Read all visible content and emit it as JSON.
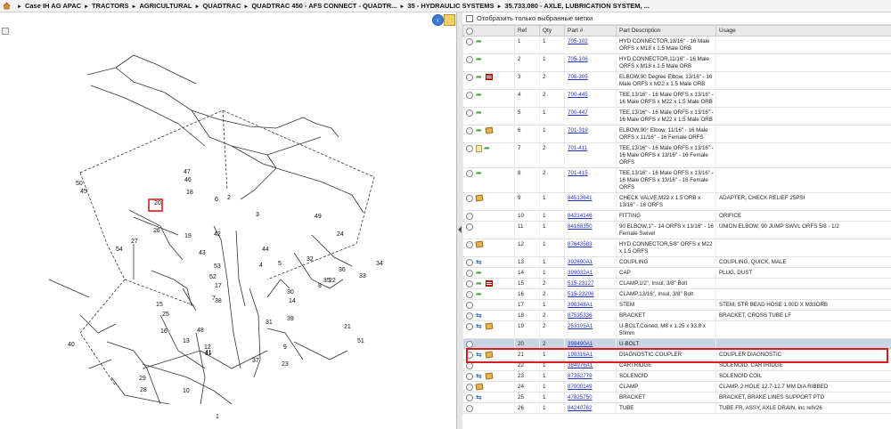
{
  "breadcrumb": {
    "items": [
      "Case IH AG APAC",
      "TRACTORS",
      "AGRICULTURAL",
      "QUADTRAC",
      "QUADTRAC 450 - AFS CONNECT - QUADTR...",
      "35 - HYDRAULIC SYSTEMS",
      "35.733.080 - AXLE, LUBRICATION SYSTEM, ..."
    ],
    "separator": "►"
  },
  "filter": {
    "label": "Отобразить только выбранные метки"
  },
  "table": {
    "headers": [
      "",
      "Ref",
      "Qty",
      "Part #",
      "Part Description",
      "Usage"
    ],
    "rows": [
      {
        "icons": [
          "arrow"
        ],
        "ref": "1",
        "qty": "1",
        "part": "705-102",
        "desc": "HYD CONNECTOR,13/16\" - 16 Male ORFS x M18 x 1.5 Male ORB",
        "usage": ""
      },
      {
        "icons": [
          "arrow"
        ],
        "ref": "2",
        "qty": "1",
        "part": "705-106",
        "desc": "HYD CONNECTOR,11/16\" - 16 Male ORFS x M18 x 1.5 Male ORB",
        "usage": ""
      },
      {
        "icons": [
          "arrow",
          "flag"
        ],
        "ref": "3",
        "qty": "2",
        "part": "708-305",
        "desc": "ELBOW,90 Degree Elbow, 13/16\" - 16 Male ORFS x M22 x 1.5 Male ORB",
        "usage": ""
      },
      {
        "icons": [
          "arrow"
        ],
        "ref": "4",
        "qty": "2",
        "part": "700-445",
        "desc": "TEE,13/16\" - 16 Male ORFS x 13/16\" - 16 Male ORFS x M22 x 1.5 Male ORB",
        "usage": ""
      },
      {
        "icons": [
          "arrow"
        ],
        "ref": "5",
        "qty": "1",
        "part": "700-447",
        "desc": "TEE,13/16\" - 16 Male ORFS x 13/16\" - 16 Male ORFS x M22 x 1.5 Male ORB",
        "usage": ""
      },
      {
        "icons": [
          "arrow",
          "box"
        ],
        "ref": "6",
        "qty": "1",
        "part": "701-319",
        "desc": "ELBOW,90° Elbow, 11/16\" - 16 Male ORFS x 11/16\" - 16 Female ORFS",
        "usage": ""
      },
      {
        "icons": [
          "note",
          "arrow"
        ],
        "ref": "7",
        "qty": "2",
        "part": "701-411",
        "desc": "TEE,13/16\" - 16 Male ORFS x 13/16\" - 16 Male ORFS x 13/16\" - 16 Female ORFS",
        "usage": ""
      },
      {
        "icons": [
          "arrow"
        ],
        "ref": "8",
        "qty": "2",
        "part": "701-415",
        "desc": "TEE,13/16\" - 16 Male ORFS x 13/16\" - 16 Male ORFS x 13/16\" - 16 Female ORFS",
        "usage": ""
      },
      {
        "icons": [
          "box"
        ],
        "ref": "9",
        "qty": "1",
        "part": "84513641",
        "desc": "CHECK VALVE,M22 x 1.5 ORB x 13/16\" - 16 ORFS",
        "usage": "ADAPTER, CHECK RELIEF 25PSI"
      },
      {
        "icons": [],
        "ref": "10",
        "qty": "1",
        "part": "84214146",
        "desc": "FITTING",
        "usage": "ORIFICE"
      },
      {
        "icons": [],
        "ref": "11",
        "qty": "1",
        "part": "84168350",
        "desc": "90 ELBOW,1\" - 14 ORFS x 13/16\" - 16 Female Swivel",
        "usage": "UNION ELBOW, 90 JUMP SWVL ORFS 5/8 - 1/2"
      },
      {
        "icons": [
          "box"
        ],
        "ref": "12",
        "qty": "1",
        "part": "87643583",
        "desc": "HYD CONNECTOR,5/8\" ORFS x M22 x 1.5 ORFS",
        "usage": ""
      },
      {
        "icons": [
          "swap"
        ],
        "ref": "13",
        "qty": "1",
        "part": "392690A1",
        "desc": "COUPLING",
        "usage": "COUPLING, QUICK, MALE"
      },
      {
        "icons": [
          "arrow"
        ],
        "ref": "14",
        "qty": "1",
        "part": "399032A1",
        "desc": "CAP",
        "usage": "PLUG, DUST"
      },
      {
        "icons": [
          "arrow",
          "flag"
        ],
        "ref": "15",
        "qty": "2",
        "part": "515-23127",
        "desc": "CLAMP,1/2\", Insul, 3/8\" Bolt",
        "usage": ""
      },
      {
        "icons": [
          "arrow"
        ],
        "ref": "16",
        "qty": "2",
        "part": "515-23206",
        "desc": "CLAMP,13/16\", Insul, 3/8\" Bolt",
        "usage": ""
      },
      {
        "icons": [],
        "ref": "17",
        "qty": "1",
        "part": "398348A1",
        "desc": "STEM",
        "usage": "STEM, STR BEAD HOSE 1.00D X M33ORB"
      },
      {
        "icons": [
          "swap"
        ],
        "ref": "18",
        "qty": "2",
        "part": "87535336",
        "desc": "BRACKET",
        "usage": "BRACKET, CROSS TUBE LF"
      },
      {
        "icons": [
          "swap",
          "box"
        ],
        "ref": "19",
        "qty": "2",
        "part": "253105A1",
        "desc": "U-BOLT,Coined, M8 x 1.25 x 33.8 x 50mm",
        "usage": ""
      },
      {
        "icons": [],
        "ref": "20",
        "qty": "2",
        "part": "398490A1",
        "desc": "U-BOLT",
        "usage": "",
        "selected": true
      },
      {
        "icons": [
          "swap",
          "box"
        ],
        "ref": "21",
        "qty": "1",
        "part": "198316A1",
        "desc": "DIAGNOSTIC COUPLER",
        "usage": "COUPLER DIAGNOSTIC"
      },
      {
        "icons": [],
        "ref": "22",
        "qty": "1",
        "part": "384976A1",
        "desc": "CARTRIDGE",
        "usage": "SOLENOID, CARTRIDGE"
      },
      {
        "icons": [
          "swap",
          "box"
        ],
        "ref": "23",
        "qty": "1",
        "part": "87352779",
        "desc": "SOLENOID",
        "usage": "SOLENOID COIL"
      },
      {
        "icons": [
          "box"
        ],
        "ref": "24",
        "qty": "1",
        "part": "87000149",
        "desc": "CLAMP",
        "usage": "CLAMP, 2 HOLE 12.7-12.7 MM DIA RIBBED"
      },
      {
        "icons": [
          "swap"
        ],
        "ref": "25",
        "qty": "1",
        "part": "47825750",
        "desc": "BRACKET",
        "usage": "BRACKET, BRAKE LINES SUPPORT PTD"
      },
      {
        "icons": [],
        "ref": "26",
        "qty": "1",
        "part": "84240762",
        "desc": "TUBE",
        "usage": "TUBE FR, ASSY, AXLE DRAIN, inc ref#26"
      }
    ]
  },
  "diagram": {
    "callouts": [
      "1",
      "2",
      "3",
      "4",
      "5",
      "6",
      "7",
      "8",
      "9",
      "10",
      "11",
      "12",
      "13",
      "14",
      "15",
      "16",
      "17",
      "18",
      "19",
      "20",
      "21",
      "22",
      "23",
      "24",
      "25",
      "26",
      "27",
      "28",
      "29",
      "30",
      "31",
      "32",
      "33",
      "34",
      "35",
      "36",
      "37",
      "38",
      "39",
      "40",
      "41",
      "42",
      "43",
      "44",
      "45",
      "46",
      "47",
      "48",
      "49",
      "50",
      "51",
      "52",
      "53",
      "54"
    ],
    "highlighted": "20"
  }
}
